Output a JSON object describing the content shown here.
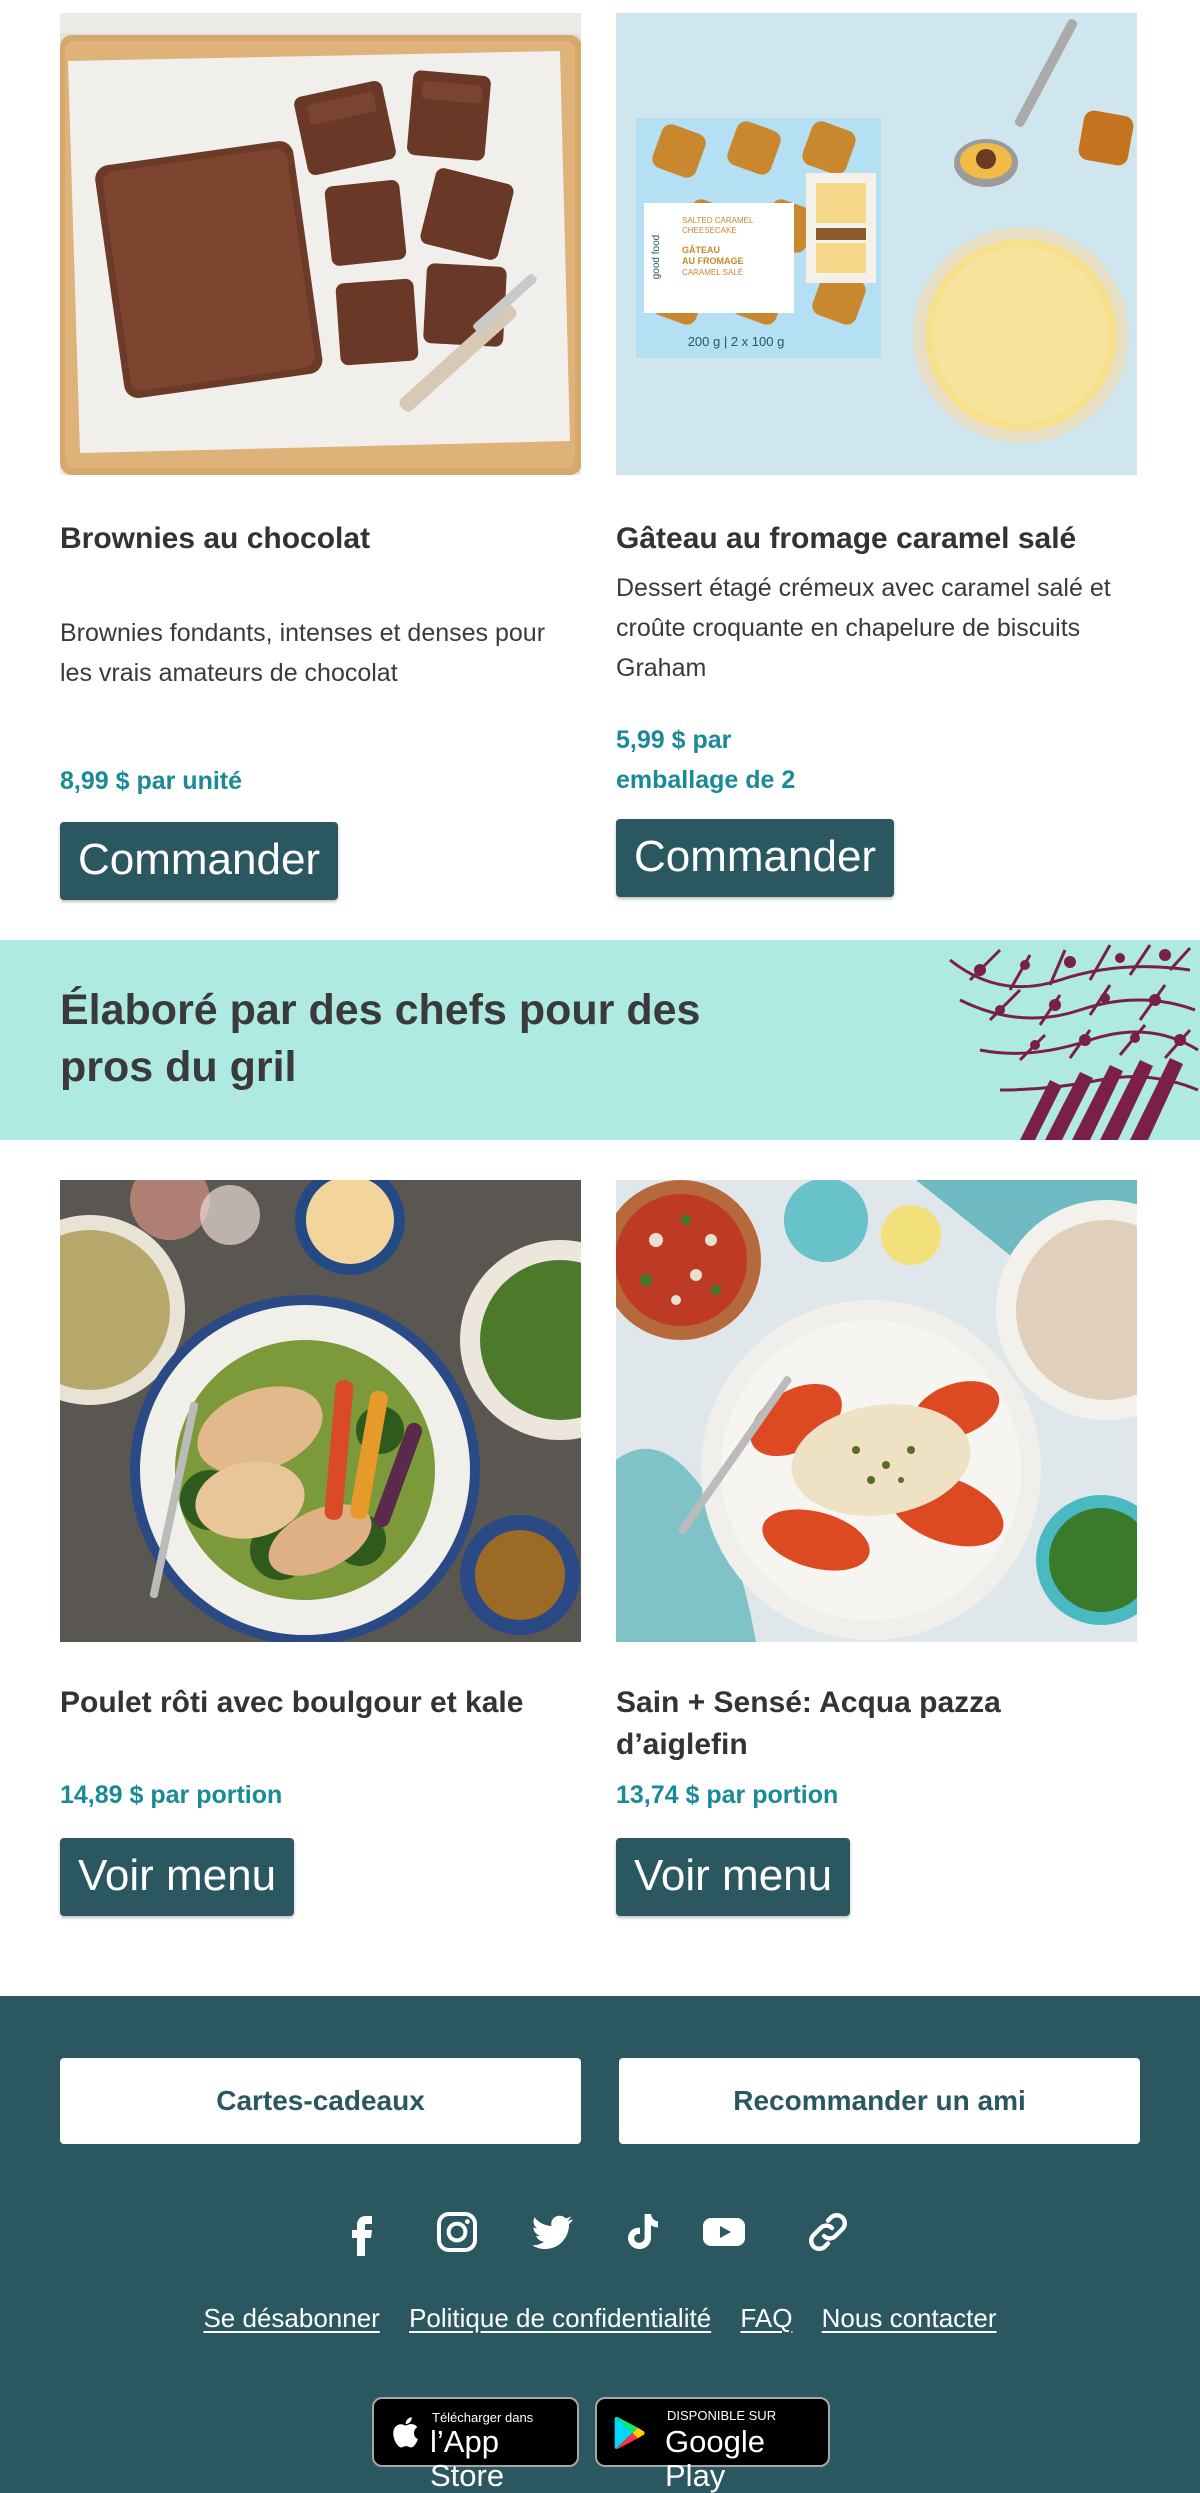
{
  "products": [
    {
      "title": "Brownies au chocolat",
      "description": "Brownies fondants, intenses et denses pour les vrais amateurs de chocolat",
      "price": "8,99 $ par unité",
      "button": "Commander"
    },
    {
      "title": "Gâteau au fromage caramel salé",
      "description": "Dessert étagé crémeux avec caramel salé et croûte croquante en chapelure de biscuits Graham",
      "price_line1": "5,99 $ par",
      "price_line2": "emballage de 2",
      "button": "Commander",
      "package": {
        "brand": "good food",
        "en_line1": "SALTED CARAMEL",
        "en_line2": "CHEESECAKE",
        "fr_line1": "GÂTEAU",
        "fr_line2": "AU FROMAGE",
        "fr_line3": "CARAMEL SALÉ",
        "weight": "200 g | 2 x 100 g"
      }
    }
  ],
  "banner": {
    "heading_line1": "Élaboré par des chefs pour des",
    "heading_line2": "pros du gril"
  },
  "meals": [
    {
      "title": "Poulet rôti avec boulgour et kale",
      "price": "14,89 $ par portion",
      "button": "Voir menu"
    },
    {
      "title_line1": "Sain + Sensé: Acqua pazza",
      "title_line2": "d’aiglefin",
      "price": "13,74 $ par portion",
      "button": "Voir menu"
    }
  ],
  "footer": {
    "gift_cards": "Cartes-cadeaux",
    "refer_friend": "Recommander un ami",
    "socials": [
      "facebook-icon",
      "instagram-icon",
      "twitter-icon",
      "tiktok-icon",
      "youtube-icon",
      "link-icon"
    ],
    "links": [
      "Se désabonner",
      "Politique de confidentialité",
      "FAQ",
      "Nous contacter"
    ],
    "app_store": {
      "small": "Télécharger dans",
      "big": "l’App Store"
    },
    "google_play": {
      "small": "DISPONIBLE SUR",
      "big": "Google Play"
    }
  },
  "colors": {
    "accent": "#2a5760",
    "price": "#1a8a99",
    "banner_bg": "#aeeae1",
    "banner_plant": "#7a1f4a"
  }
}
